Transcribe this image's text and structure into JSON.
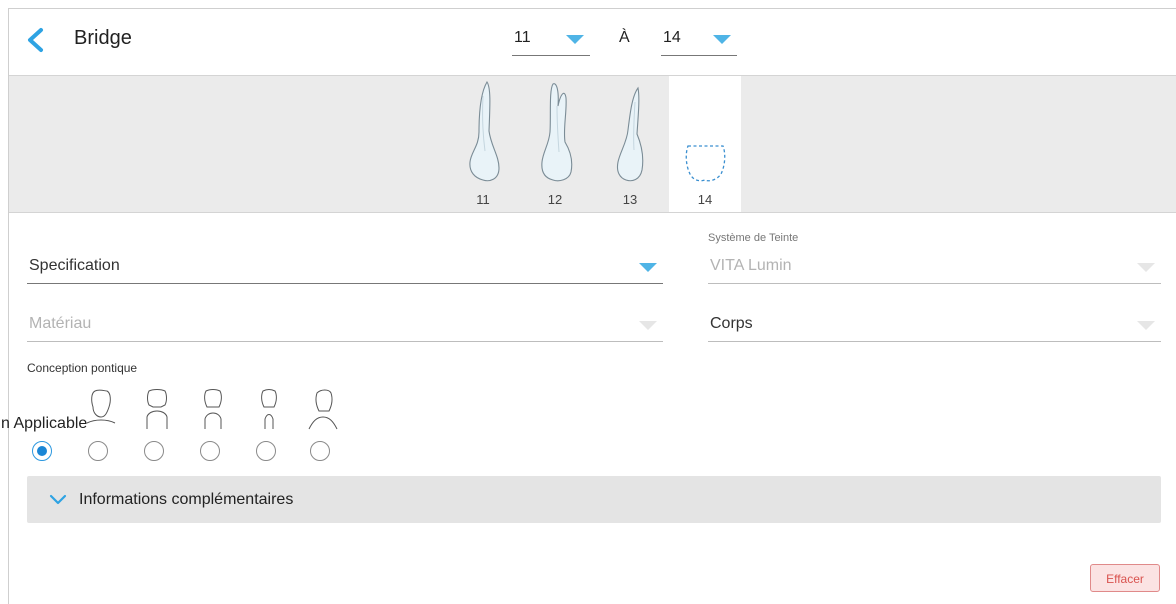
{
  "header": {
    "back_icon": "chevron-left-icon",
    "title": "Bridge",
    "range_from": "11",
    "range_separator": "À",
    "range_to": "14",
    "accent_color": "#4fb4e6"
  },
  "teeth": [
    {
      "number": "11",
      "state": "present"
    },
    {
      "number": "12",
      "state": "present"
    },
    {
      "number": "13",
      "state": "present"
    },
    {
      "number": "14",
      "state": "missing",
      "selected": true
    }
  ],
  "form": {
    "specification": {
      "label": "Specification"
    },
    "shade_system": {
      "caption": "Système de Teinte",
      "value": "VITA Lumin"
    },
    "material": {
      "label": "Matériau"
    },
    "body": {
      "label": "Corps"
    }
  },
  "pontic": {
    "label": "Conception pontique",
    "not_applicable_label": "n Applicable",
    "options": [
      {
        "icon": "tooth-pontic-icon",
        "checked": true
      },
      {
        "icon": "tooth-pontic-icon",
        "checked": false
      },
      {
        "icon": "tooth-pontic-icon",
        "checked": false
      },
      {
        "icon": "tooth-pontic-icon",
        "checked": false
      },
      {
        "icon": "tooth-pontic-icon",
        "checked": false
      },
      {
        "icon": "tooth-pontic-icon",
        "checked": false
      }
    ]
  },
  "accordion": {
    "icon": "chevron-down-icon",
    "label": "Informations complémentaires"
  },
  "footer": {
    "clear_label": "Effacer",
    "clear_color": "#d9534f"
  }
}
